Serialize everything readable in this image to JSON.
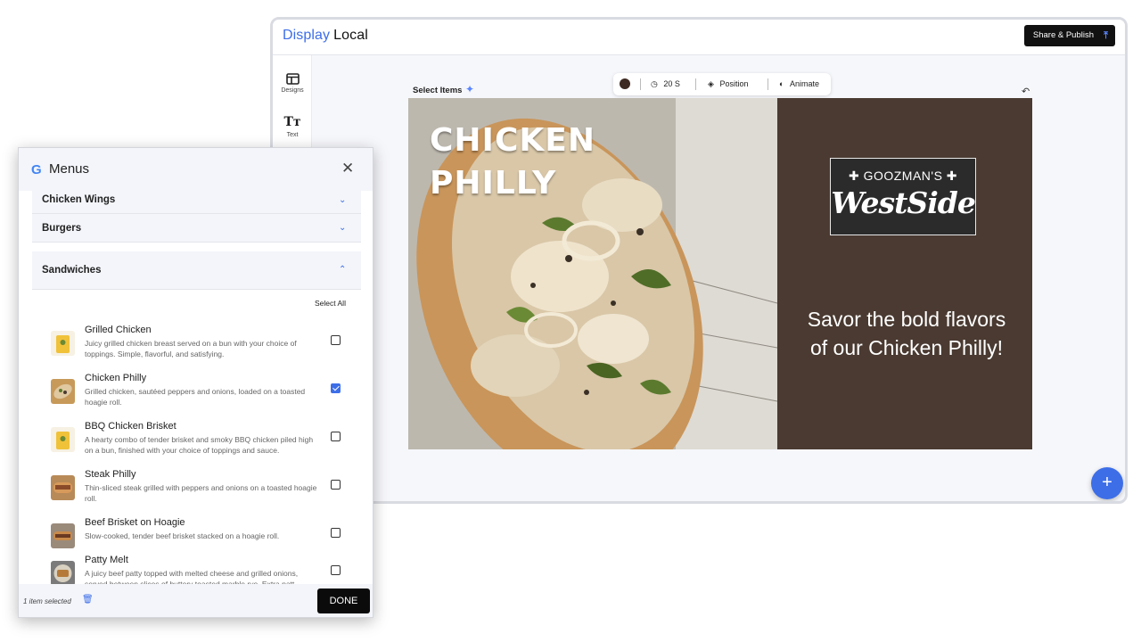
{
  "app": {
    "brand_part1": "Display",
    "brand_part2": "Local",
    "share_label": "Share & Publish",
    "rail": [
      {
        "label": "Designs",
        "icon": "layout-icon"
      },
      {
        "label": "Text",
        "icon": "text-icon"
      }
    ],
    "select_items_label": "Select Items",
    "toolbar": {
      "color": "#3d2a22",
      "duration": "20 S",
      "position": "Position",
      "animate": "Animate"
    },
    "slide": {
      "headline_line1": "CHICKEN",
      "headline_line2": "PHILLY",
      "logo_top": "✚ GOOZMAN'S ✚",
      "logo_main": "WestSide",
      "tagline": "Savor the bold flavors of our Chicken Philly!",
      "background_color": "#4a3a31"
    }
  },
  "menus": {
    "title": "Menus",
    "categories": [
      {
        "label": "Chicken Wings",
        "expanded": false
      },
      {
        "label": "Burgers",
        "expanded": false
      },
      {
        "label": "Sandwiches",
        "expanded": true
      }
    ],
    "select_all": "Select All",
    "items": [
      {
        "name": "Grilled Chicken",
        "desc": "Juicy grilled chicken breast served on a bun with your choice of toppings. Simple, flavorful, and satisfying.",
        "checked": false
      },
      {
        "name": "Chicken Philly",
        "desc": "Grilled chicken, sautéed peppers and onions, loaded on a toasted hoagie roll.",
        "checked": true
      },
      {
        "name": "BBQ Chicken Brisket",
        "desc": "A hearty combo of tender brisket and smoky BBQ chicken piled high on a bun, finished with your choice of toppings and sauce.",
        "checked": false
      },
      {
        "name": "Steak Philly",
        "desc": "Thin-sliced steak grilled with peppers and onions on a toasted hoagie roll.",
        "checked": false
      },
      {
        "name": "Beef Brisket on Hoagie",
        "desc": "Slow-cooked, tender beef brisket stacked on a hoagie roll.",
        "checked": false
      },
      {
        "name": "Patty Melt",
        "desc": "A juicy beef patty topped with melted cheese and grilled onions, served between slices of buttery toasted marble rye. Extra patt",
        "checked": false
      }
    ],
    "footer": {
      "selected_text": "1 item selected",
      "done_label": "DONE"
    }
  },
  "colors": {
    "accent": "#3d6ee8",
    "dark_button": "#111111"
  }
}
